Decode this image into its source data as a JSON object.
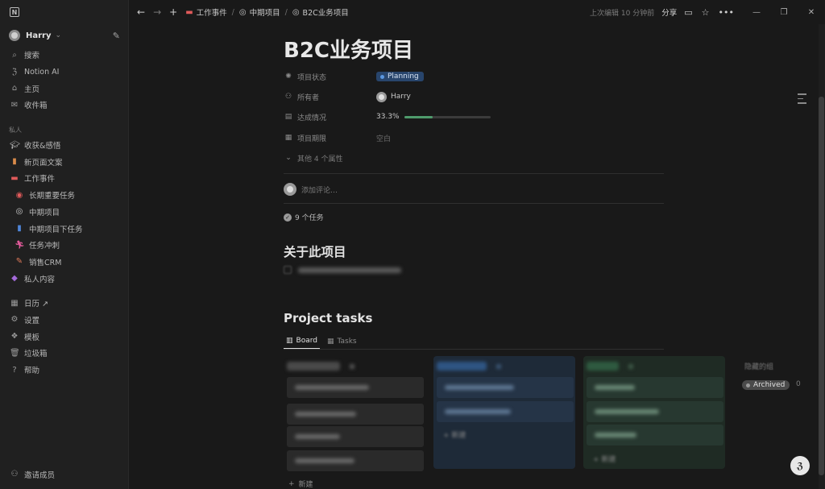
{
  "sidebar": {
    "workspace_name": "Harry",
    "top_items": [
      {
        "label": "搜索",
        "icon": "search-icon"
      },
      {
        "label": "Notion AI",
        "icon": "notion-ai-icon"
      },
      {
        "label": "主页",
        "icon": "home-icon"
      },
      {
        "label": "收件箱",
        "icon": "inbox-icon"
      }
    ],
    "private_section": "私人",
    "private_items": [
      {
        "label": "收获&感悟",
        "icon": "graduation-cap-icon"
      },
      {
        "label": "新页面文案",
        "icon": "book-icon"
      },
      {
        "label": "工作事件",
        "icon": "laptop-icon"
      }
    ],
    "work_children": [
      {
        "label": "长期重要任务",
        "icon": "target-icon"
      },
      {
        "label": "中期项目",
        "icon": "spiral-icon"
      },
      {
        "label": "中期项目下任务",
        "icon": "notebook-icon"
      },
      {
        "label": "任务冲刺",
        "icon": "runner-icon"
      },
      {
        "label": "销售CRM",
        "icon": "megaphone-icon"
      }
    ],
    "private_tail": {
      "label": "私人内容",
      "icon": "gamepad-icon"
    },
    "tools": [
      {
        "label": "日历 ↗",
        "icon": "calendar-icon"
      },
      {
        "label": "设置",
        "icon": "gear-icon"
      },
      {
        "label": "模板",
        "icon": "template-icon"
      },
      {
        "label": "垃圾箱",
        "icon": "trash-icon"
      },
      {
        "label": "帮助",
        "icon": "help-icon"
      }
    ],
    "invite_label": "邀请成员"
  },
  "topbar": {
    "breadcrumbs": [
      "工作事件",
      "中期项目",
      "B2C业务项目"
    ],
    "edited_text": "上次编辑 10 分钟前",
    "share_label": "分享"
  },
  "page": {
    "title": "B2C业务项目",
    "properties": {
      "status": {
        "label": "项目状态",
        "value": "Planning"
      },
      "owner": {
        "label": "所有者",
        "value": "Harry"
      },
      "progress": {
        "label": "达成情况",
        "value": "33.3%",
        "fraction": 0.333
      },
      "deadline": {
        "label": "项目期限",
        "value": "空白"
      },
      "more": "其他 4 个属性"
    },
    "comment_placeholder": "添加评论…",
    "tasks_count": "9 个任务",
    "about_heading": "关于此项目",
    "project_tasks_heading": "Project tasks",
    "tabs": [
      {
        "label": "Board",
        "icon": "board-icon",
        "active": true
      },
      {
        "label": "Tasks",
        "icon": "table-icon",
        "active": false
      }
    ],
    "new_label": "新建",
    "hidden_groups_label": "隐藏的组",
    "archived_label": "Archived",
    "archived_count": "0"
  },
  "colors": {
    "background": "#191919",
    "sidebar": "#202020",
    "status_pill": "#28456c",
    "progress_green": "#4f9b6c",
    "column_blue": "#1e2a38",
    "column_green": "#1f2b24"
  }
}
